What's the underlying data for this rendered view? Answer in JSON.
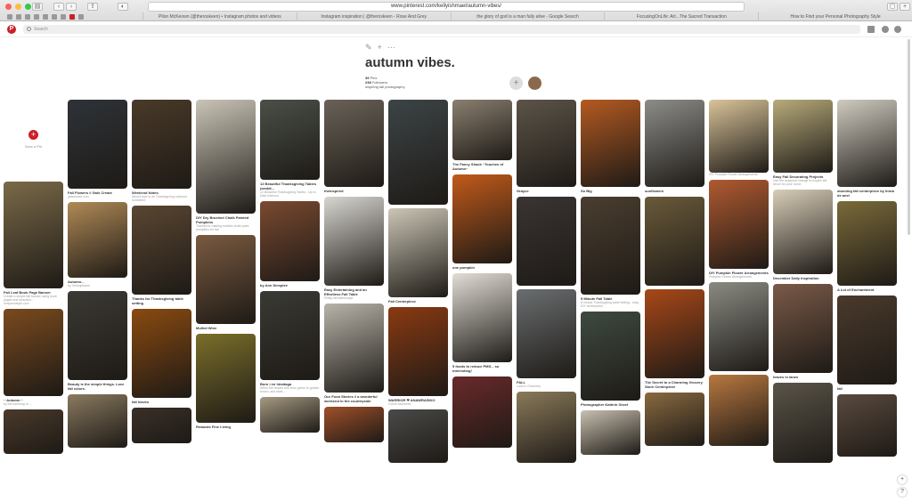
{
  "browser": {
    "url": "www.pinterest.com/kellyishmael/autumn-vibes/",
    "tabs": [
      "Pilon McKeown (@theroskeen) • Instagram photos and videos",
      "Instagram inspiration | @theroskeen - Rose And Grey",
      "the glory of god is a man fully alive - Google Search",
      "FocusingOnLife: Art...The Sacred Transaction",
      "How to Find your Personal Photography Style"
    ]
  },
  "header": {
    "search_placeholder": "Search"
  },
  "board": {
    "title": "autumn vibes.",
    "pins_count": "39",
    "pins_label": "Pins",
    "followers_count": "238",
    "followers_label": "Followers",
    "description": "inspiring fall photography"
  },
  "save_pin_label": "Save a Pin",
  "columns": [
    [
      {
        "title": "Fall Leaf Book Page Banner",
        "desc": "Create a simple fall banner using book pages and beautiful...",
        "src": "inmyownstyle.com",
        "h": 120,
        "color": "#7a6a48"
      },
      {
        "title": "~ Autumn ~",
        "desc": "by the tumbling of ...",
        "src": "",
        "h": 98,
        "color": "#7a4a1e"
      },
      {
        "title": "",
        "desc": "",
        "src": "",
        "h": 50,
        "color": "#4a3a2a"
      }
    ],
    [
      {
        "title": "Fall Flowers // Gals Create",
        "desc": "",
        "src": "galscreate.com",
        "h": 100,
        "color": "#2e3338"
      },
      {
        "title": "Autumn...",
        "desc": "by Yehoophotos",
        "src": "",
        "h": 85,
        "color": "#b08a56"
      },
      {
        "title": "Beauty is the simple things. Love fall colors.",
        "desc": "",
        "src": "",
        "h": 100,
        "color": "#3c3a34"
      },
      {
        "title": "",
        "desc": "",
        "src": "",
        "h": 60,
        "color": "#8a7a60"
      }
    ],
    [
      {
        "title": "Weekend Notes",
        "desc": "Would love to do Thanksgiving outdoors sometime.",
        "src": "",
        "h": 100,
        "color": "#4a3a28"
      },
      {
        "title": "Thanks for Thanksgiving table setting",
        "desc": "",
        "src": "",
        "h": 100,
        "color": "#5a4632"
      },
      {
        "title": "fall leaves",
        "desc": "",
        "src": "",
        "h": 100,
        "color": "#8a4a10"
      },
      {
        "title": "",
        "desc": "",
        "src": "",
        "h": 40,
        "color": "#3a3028"
      }
    ],
    [
      {
        "title": "DIY Dry Brushed Chalk Painted Pumpkins",
        "desc": "Tutorial for making realistic chalk paint pumpkins for fall.",
        "src": "",
        "h": 128,
        "color": "#c9c4b6"
      },
      {
        "title": "Mulled Wine",
        "desc": "",
        "src": "",
        "h": 100,
        "color": "#7a5a40"
      },
      {
        "title": "Rewards Fine Living",
        "desc": "",
        "src": "",
        "h": 100,
        "color": "#7a6e2a"
      }
    ],
    [
      {
        "title": "12 Beautiful Thanksgiving Tables (weddi...",
        "desc": "12 Beautiful Thanksgiving Tables - Up to Date Interiors",
        "src": "",
        "h": 90,
        "color": "#4a5048"
      },
      {
        "title": "by Ann Semplee",
        "desc": "",
        "src": "",
        "h": 90,
        "color": "#7a4a30"
      },
      {
        "title": "Born i en hösttaga",
        "desc": "When the leaves turn from green to golden brown, and start...",
        "src": "",
        "h": 100,
        "color": "#3a3a34"
      },
      {
        "title": "",
        "desc": "",
        "src": "",
        "h": 40,
        "color": "#a59a82"
      }
    ],
    [
      {
        "title": "theinspired",
        "desc": "",
        "src": "",
        "h": 98,
        "color": "#6a6258"
      },
      {
        "title": "Easy Entertaining and an Effortless Fall Table",
        "desc": "Pretty fall tablescape",
        "src": "",
        "h": 100,
        "color": "#d8d6d0"
      },
      {
        "title": "Our Food Stories // a wonderful weekend in the countryside",
        "desc": "",
        "src": "",
        "h": 100,
        "color": "#b8b4aa"
      },
      {
        "title": "",
        "desc": "",
        "src": "",
        "h": 40,
        "color": "#a0502a"
      }
    ],
    [
      {
        "title": "",
        "desc": "",
        "src": "",
        "h": 118,
        "color": "#3c4446"
      },
      {
        "title": "Fall Centerpiece",
        "desc": "",
        "src": "",
        "h": 100,
        "color": "#ccc6b6"
      },
      {
        "title": "WARRIOR ❤ ANAWRASIKO",
        "desc": "Good road trees",
        "src": "",
        "h": 100,
        "color": "#8a3a12"
      },
      {
        "title": "",
        "desc": "",
        "src": "",
        "h": 60,
        "color": "#4a4a48"
      }
    ],
    [
      {
        "title": "The Fancy Shack ~Touches of Autumn~",
        "desc": "",
        "src": "",
        "h": 68,
        "color": "#8a8070"
      },
      {
        "title": "one pumpkin",
        "desc": "",
        "src": "",
        "h": 100,
        "color": "#c25a1a"
      },
      {
        "title": "5 foods to reduce PMS... so interesting!",
        "desc": "",
        "src": "",
        "h": 100,
        "color": "#e2ded6"
      },
      {
        "title": "",
        "desc": "",
        "src": "",
        "h": 80,
        "color": "#6a2a2a"
      }
    ],
    [
      {
        "title": "Grayce",
        "desc": "",
        "src": "",
        "h": 98,
        "color": "#5c5448"
      },
      {
        "title": "",
        "desc": "",
        "src": "",
        "h": 100,
        "color": "#3a3432"
      },
      {
        "title": "FALL",
        "desc": "Love in Greenery",
        "src": "",
        "h": 100,
        "color": "#6a6e70"
      },
      {
        "title": "",
        "desc": "",
        "src": "",
        "h": 80,
        "color": "#8a7a5a"
      }
    ],
    [
      {
        "title": "So Big",
        "desc": "",
        "src": "",
        "h": 98,
        "color": "#b45a22"
      },
      {
        "title": "5 Minute Fall Table",
        "desc": "5 minute Thanksgiving table setting - easy DIY centerpiece.",
        "src": "",
        "h": 110,
        "color": "#4a3e30"
      },
      {
        "title": "Photographer Kathrin Groet",
        "desc": "",
        "src": "",
        "h": 100,
        "color": "#3e4a40"
      },
      {
        "title": "",
        "desc": "",
        "src": "",
        "h": 50,
        "color": "#c8c0b0"
      }
    ],
    [
      {
        "title": "sunflowers",
        "desc": "",
        "src": "",
        "h": 98,
        "color": "#8c8c88"
      },
      {
        "title": "",
        "desc": "",
        "src": "",
        "h": 100,
        "color": "#6a5a3a"
      },
      {
        "title": "The Secret to a Charming Grocery Store Centerpiece",
        "desc": "",
        "src": "",
        "h": 100,
        "color": "#a84818"
      },
      {
        "title": "",
        "desc": "",
        "src": "",
        "h": 60,
        "color": "#8a6a40"
      }
    ],
    [
      {
        "title": "",
        "desc": "DIY Pumpkin Flower Arrangements",
        "src": "",
        "h": 82,
        "color": "#d9c49a"
      },
      {
        "title": "DIY Pumpkin Flower Arrangements",
        "desc": "Pumpkin Flower Arrangements",
        "src": "",
        "h": 100,
        "color": "#b05a30"
      },
      {
        "title": "",
        "desc": "",
        "src": "",
        "h": 100,
        "color": "#8a8a82"
      },
      {
        "title": "",
        "desc": "",
        "src": "",
        "h": 80,
        "color": "#b87840"
      }
    ],
    [
      {
        "title": "Easy Fall Decorating Projects",
        "desc": "Use the seasonal change to inspire fall decor for your home.",
        "src": "",
        "h": 82,
        "color": "#b8ab7a"
      },
      {
        "title": "December Daily Inspiration",
        "desc": "",
        "src": "",
        "h": 95,
        "color": "#d8cdb8"
      },
      {
        "title": "leaves in lanes",
        "desc": "",
        "src": "",
        "h": 100,
        "color": "#7a5a48"
      },
      {
        "title": "",
        "desc": "",
        "src": "",
        "h": 90,
        "color": "#5a5448"
      }
    ],
    [
      {
        "title": "stunning fall centerpiece by Inizio de anel",
        "desc": "",
        "src": "",
        "h": 98,
        "color": "#cfcbc0"
      },
      {
        "title": "A Lot of Enchantment",
        "desc": "",
        "src": "",
        "h": 95,
        "color": "#7a6a3a"
      },
      {
        "title": "fall",
        "desc": "",
        "src": "",
        "h": 100,
        "color": "#4a3a2c"
      },
      {
        "title": "",
        "desc": "",
        "src": "",
        "h": 70,
        "color": "#5a4a3e"
      }
    ]
  ]
}
